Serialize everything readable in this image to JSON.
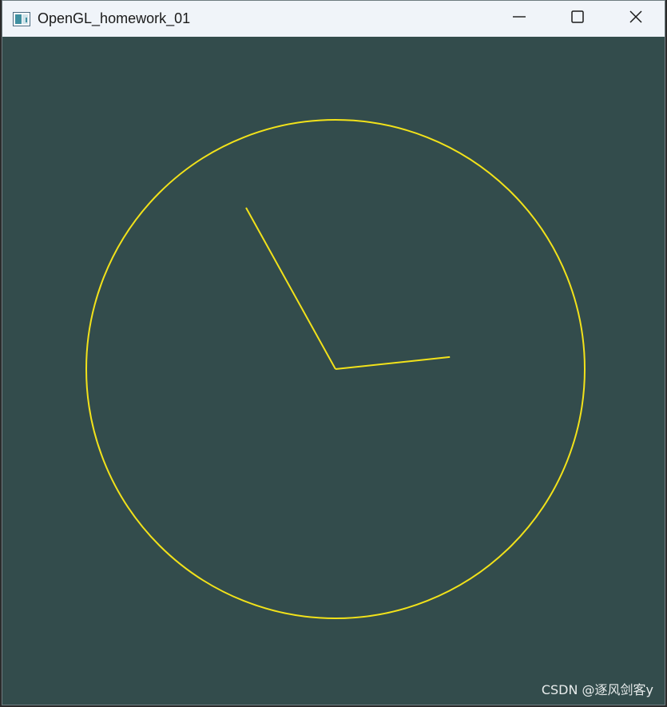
{
  "window": {
    "title": "OpenGL_homework_01",
    "background_color": "#334c4c",
    "titlebar_color": "#f0f4f9"
  },
  "controls": {
    "minimize_icon": "minimize-icon",
    "maximize_icon": "maximize-icon",
    "close_icon": "close-icon"
  },
  "clock": {
    "stroke_color": "#f2e21a",
    "hour_hand_angle_deg": -29,
    "minute_hand_angle_deg": 84
  },
  "watermark": {
    "text": "CSDN @逐风剑客y"
  }
}
